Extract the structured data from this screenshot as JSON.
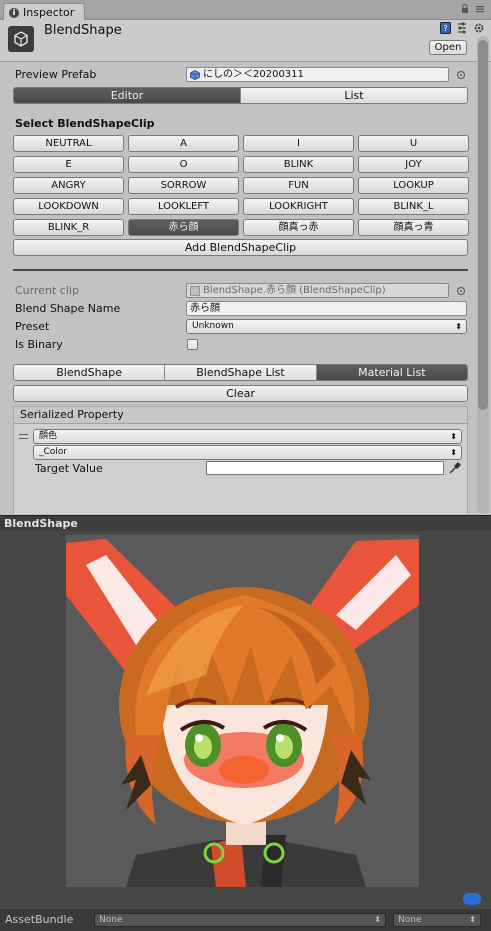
{
  "tab": {
    "title": "Inspector"
  },
  "header": {
    "title": "BlendShape",
    "open_label": "Open"
  },
  "preview_prefab": {
    "label": "Preview Prefab",
    "value": "にしの＞＜20200311"
  },
  "mode_tabs": [
    {
      "label": "Editor",
      "active": true
    },
    {
      "label": "List",
      "active": false
    }
  ],
  "select_title": "Select BlendShapeClip",
  "clips": [
    {
      "label": "NEUTRAL",
      "active": false
    },
    {
      "label": "A",
      "active": false
    },
    {
      "label": "I",
      "active": false
    },
    {
      "label": "U",
      "active": false
    },
    {
      "label": "E",
      "active": false
    },
    {
      "label": "O",
      "active": false
    },
    {
      "label": "BLINK",
      "active": false
    },
    {
      "label": "JOY",
      "active": false
    },
    {
      "label": "ANGRY",
      "active": false
    },
    {
      "label": "SORROW",
      "active": false
    },
    {
      "label": "FUN",
      "active": false
    },
    {
      "label": "LOOKUP",
      "active": false
    },
    {
      "label": "LOOKDOWN",
      "active": false
    },
    {
      "label": "LOOKLEFT",
      "active": false
    },
    {
      "label": "LOOKRIGHT",
      "active": false
    },
    {
      "label": "BLINK_L",
      "active": false
    },
    {
      "label": "BLINK_R",
      "active": false
    },
    {
      "label": "赤ら顔",
      "active": true
    },
    {
      "label": "顔真っ赤",
      "active": false
    },
    {
      "label": "顔真っ青",
      "active": false
    }
  ],
  "add_clip_label": "Add BlendShapeClip",
  "current_clip": {
    "label": "Current clip",
    "value": "BlendShape.赤ら顔 (BlendShapeClip)"
  },
  "blend_shape_name": {
    "label": "Blend Shape Name",
    "value": "赤ら顔"
  },
  "preset": {
    "label": "Preset",
    "value": "Unknown"
  },
  "is_binary": {
    "label": "Is Binary",
    "checked": false
  },
  "sub_tabs": [
    {
      "label": "BlendShape",
      "active": false
    },
    {
      "label": "BlendShape List",
      "active": false
    },
    {
      "label": "Material List",
      "active": true
    }
  ],
  "clear_label": "Clear",
  "serialized": {
    "title": "Serialized Property",
    "material": "顔色",
    "property": "_Color",
    "target_label": "Target Value",
    "target_color": "#ffffff"
  },
  "preview": {
    "title": "BlendShape"
  },
  "asset_bundle": {
    "label": "AssetBundle",
    "name": "None",
    "variant": "None"
  }
}
